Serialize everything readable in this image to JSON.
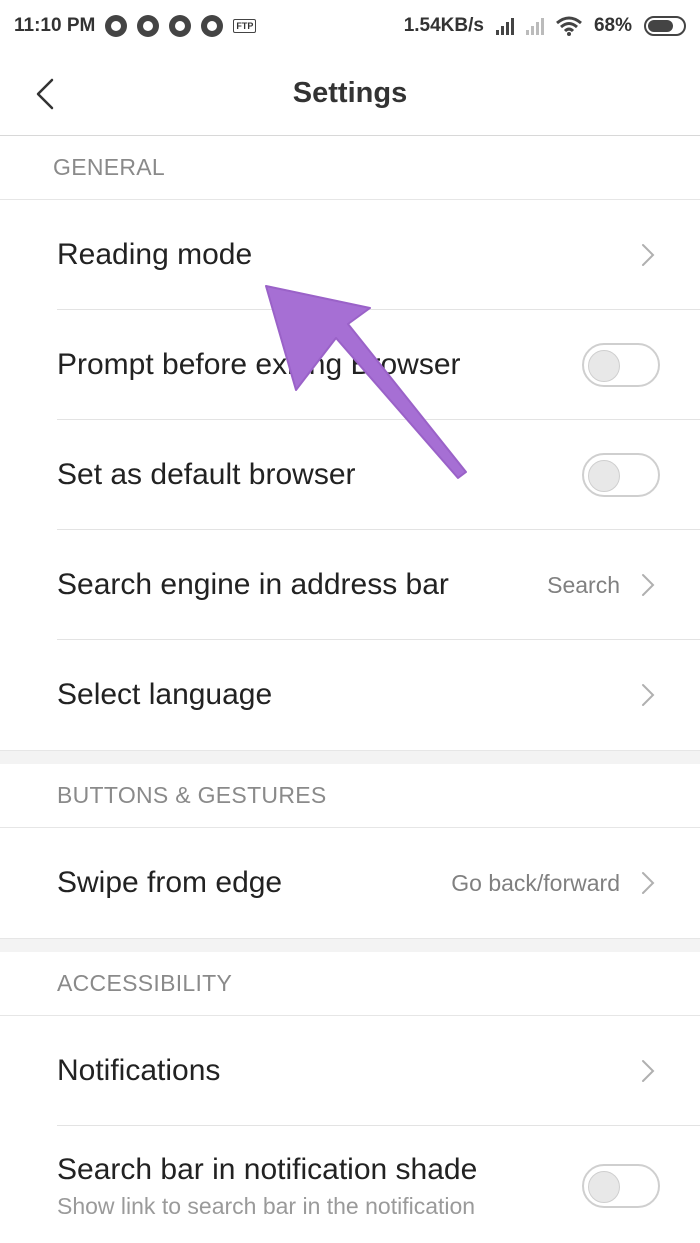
{
  "status_bar": {
    "time": "11:10 PM",
    "ftp_label": "FTP",
    "speed": "1.54KB/s",
    "battery": "68%",
    "icons": [
      "aperture-icon",
      "aperture-icon",
      "aperture-icon",
      "aperture-icon",
      "ftp-icon",
      "signal-icon",
      "signal-off-icon",
      "wifi-icon",
      "battery-icon"
    ]
  },
  "header": {
    "title": "Settings",
    "back_icon": "chevron-left-icon"
  },
  "sections": {
    "general": {
      "title": "GENERAL",
      "items": {
        "reading_mode": {
          "label": "Reading mode"
        },
        "prompt_exit": {
          "label": "Prompt before exiting Browser",
          "enabled": false
        },
        "default_browser": {
          "label": "Set as default browser",
          "enabled": false
        },
        "search_engine": {
          "label": "Search engine in address bar",
          "value": "Search"
        },
        "language": {
          "label": "Select language"
        }
      }
    },
    "buttons_gestures": {
      "title": "BUTTONS & GESTURES",
      "items": {
        "swipe_edge": {
          "label": "Swipe from edge",
          "value": "Go back/forward"
        }
      }
    },
    "accessibility": {
      "title": "ACCESSIBILITY",
      "items": {
        "notifications": {
          "label": "Notifications"
        },
        "search_bar_shade": {
          "label": "Search bar in notification shade",
          "sub": "Show link to search bar in the notification",
          "enabled": false
        }
      }
    }
  },
  "annotation": {
    "arrow_color": "#a66fd4"
  },
  "colors": {
    "section_text": "#8a8a8a",
    "divider": "#e3e3e3",
    "value_text": "#808080"
  }
}
